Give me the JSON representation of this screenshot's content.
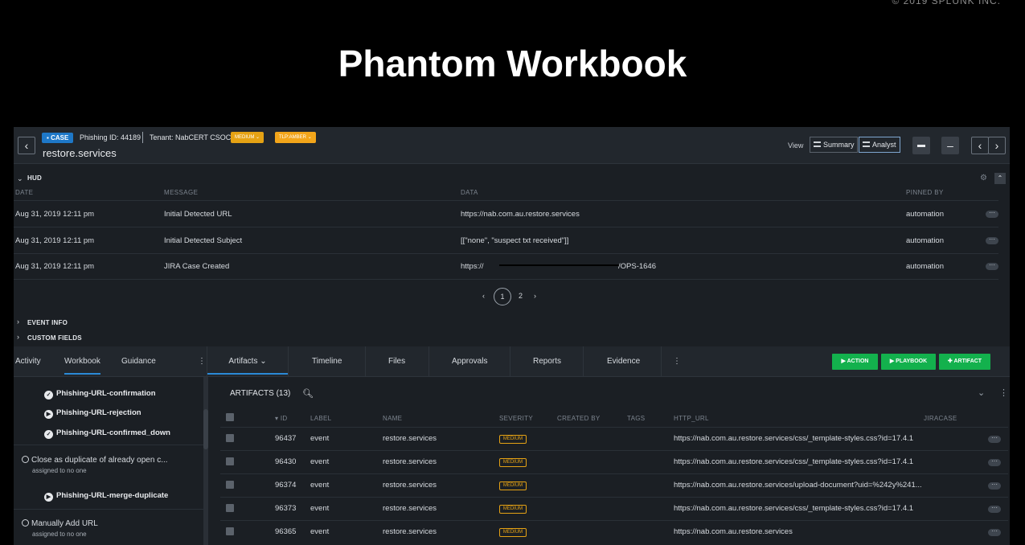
{
  "slide": {
    "title": "Phantom Workbook",
    "copyright": "© 2019 SPLUNK INC."
  },
  "header": {
    "back_icon": "chevron-left-icon",
    "case_badge": "CASE",
    "case_id": "Phishing ID: 44189",
    "tenant": "Tenant: NabCERT CSOC",
    "severity_chip": "MEDIUM",
    "tlp_chip": "TLP:AMBER",
    "case_name": "restore.services",
    "view_label": "View",
    "view_summary": "Summary",
    "view_analyst": "Analyst",
    "briefcase_icon": "briefcase-icon",
    "minus_icon": "minus-icon",
    "prev": "‹",
    "next": "›"
  },
  "hud": {
    "label": "HUD",
    "columns": [
      "DATE",
      "MESSAGE",
      "DATA",
      "PINNED BY"
    ],
    "rows": [
      {
        "date": "Aug 31, 2019 12:11 pm",
        "message": "Initial Detected URL",
        "data": "https://nab.com.au.restore.services",
        "pinned_by": "automation"
      },
      {
        "date": "Aug 31, 2019 12:11 pm",
        "message": "Initial Detected Subject",
        "data": "[[\"none\", \"suspect txt received\"]]",
        "pinned_by": "automation"
      },
      {
        "date": "Aug 31, 2019 12:11 pm",
        "message": "JIRA Case Created",
        "data": "https://",
        "data_suffix": "/OPS-1646",
        "pinned_by": "automation"
      }
    ],
    "pages": [
      "‹",
      "1",
      "2",
      "›"
    ],
    "current_page": 1
  },
  "sections": {
    "event_info": "EVENT INFO",
    "custom_fields": "CUSTOM FIELDS"
  },
  "left_tabs": [
    "Activity",
    "Workbook",
    "Guidance"
  ],
  "main_tabs": [
    "Artifacts",
    "Timeline",
    "Files",
    "Approvals",
    "Reports",
    "Evidence"
  ],
  "action_buttons": [
    "ACTION",
    "PLAYBOOK",
    "ARTIFACT"
  ],
  "workbook": {
    "items_top": [
      {
        "label": "Phishing-URL-confirmation",
        "icon": "check-circle-icon"
      },
      {
        "label": "Phishing-URL-rejection",
        "icon": "play-circle-icon"
      },
      {
        "label": "Phishing-URL-confirmed_down",
        "icon": "check-circle-icon"
      }
    ],
    "task1": {
      "label": "Close as duplicate of already open c...",
      "sub": "assigned to no one"
    },
    "task1_item": {
      "label": "Phishing-URL-merge-duplicate",
      "icon": "play-circle-icon"
    },
    "task2": {
      "label": "Manually Add URL",
      "sub": "assigned to no one"
    }
  },
  "artifacts": {
    "title": "ARTIFACTS (13)",
    "columns": [
      "ID",
      "LABEL",
      "NAME",
      "SEVERITY",
      "CREATED BY",
      "TAGS",
      "HTTP_URL",
      "JIRACASE"
    ],
    "rows": [
      {
        "id": "96437",
        "label": "event",
        "name": "restore.services",
        "severity": "MEDIUM",
        "url": "https://nab.com.au.restore.services/css/_template-styles.css?id=17.4.1"
      },
      {
        "id": "96430",
        "label": "event",
        "name": "restore.services",
        "severity": "MEDIUM",
        "url": "https://nab.com.au.restore.services/css/_template-styles.css?id=17.4.1"
      },
      {
        "id": "96374",
        "label": "event",
        "name": "restore.services",
        "severity": "MEDIUM",
        "url": "https://nab.com.au.restore.services/upload-document?uid=%242y%241..."
      },
      {
        "id": "96373",
        "label": "event",
        "name": "restore.services",
        "severity": "MEDIUM",
        "url": "https://nab.com.au.restore.services/css/_template-styles.css?id=17.4.1"
      },
      {
        "id": "96365",
        "label": "event",
        "name": "restore.services",
        "severity": "MEDIUM",
        "url": "https://nab.com.au.restore.services"
      }
    ]
  },
  "colors": {
    "accent_blue": "#1e78c8",
    "green": "#13b14d",
    "amber": "#e5a214"
  }
}
